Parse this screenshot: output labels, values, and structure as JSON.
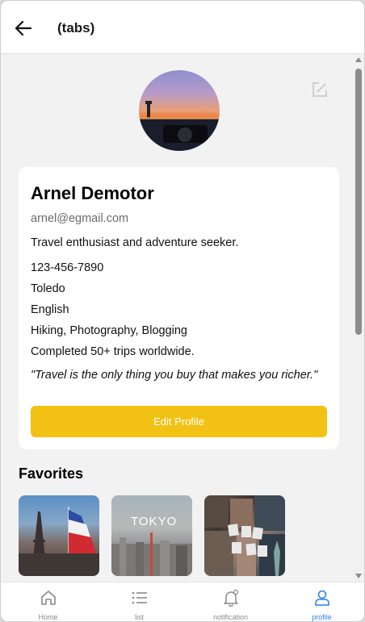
{
  "header": {
    "title": "(tabs)"
  },
  "profile": {
    "name": "Arnel Demotor",
    "email": "arnel@egmail.com",
    "bio": "Travel enthusiast and adventure seeker.",
    "phone": "123-456-7890",
    "location": "Toledo",
    "language": "English",
    "interests": "Hiking, Photography, Blogging",
    "achievement": "Completed 50+ trips worldwide.",
    "quote": "\"Travel is the only thing you buy that makes you richer.\"",
    "edit_button": "Edit Profile"
  },
  "favorites": {
    "title": "Favorites",
    "items": [
      {
        "icon": "paris-photo"
      },
      {
        "label": "TOKYO",
        "icon": "tokyo-photo"
      },
      {
        "icon": "new-york-collage"
      }
    ]
  },
  "tabs": [
    {
      "label": "Home",
      "icon": "home-icon"
    },
    {
      "label": "list",
      "icon": "list-icon"
    },
    {
      "label": "notification",
      "icon": "bell-icon"
    },
    {
      "label": "profile",
      "icon": "user-icon",
      "active": true
    }
  ],
  "colors": {
    "accent": "#f1c214",
    "active_tab": "#2f80ed",
    "background": "#f2f2f2"
  }
}
